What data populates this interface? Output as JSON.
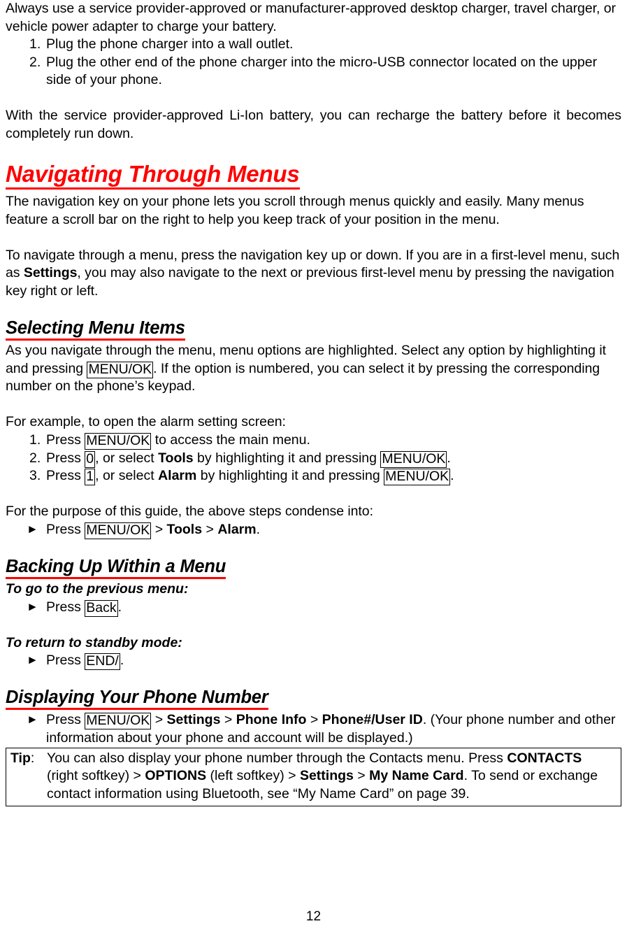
{
  "document": {
    "page_number": "12",
    "intro": {
      "paragraph": "Always use a service provider-approved or manufacturer-approved desktop charger, travel charger, or vehicle power adapter to charge your battery.",
      "steps": [
        {
          "number": "1.",
          "text": "Plug the phone charger into a wall outlet."
        },
        {
          "number": "2.",
          "text": "Plug the other end of the phone charger into the micro-USB connector located on the upper side of your phone."
        }
      ],
      "note": "With the service provider-approved Li-Ion battery, you can recharge the battery before it becomes completely run down."
    },
    "sections": [
      {
        "heading": "Navigating Through Menus",
        "paragraph1": "The navigation key on your phone lets you scroll through menus quickly and easily. Many menus feature a scroll bar on the right to help you keep track of your position in the menu.",
        "paragraph2_a": "To navigate through a menu, press the navigation key up or down. If you are in a first-level menu, such as ",
        "paragraph2_bold": "Settings",
        "paragraph2_b": ", you may also navigate to the next or previous first-level menu by pressing the navigation key right or left."
      },
      {
        "heading": "Selecting Menu Items",
        "paragraph1_a": "As you navigate through the menu, menu options are highlighted. Select any option by highlighting it and pressing ",
        "paragraph1_key": "MENU/OK",
        "paragraph1_b": ". If the option is numbered, you can select it by pressing the corresponding number on the phone’s keypad.",
        "example_intro": "For example, to open the alarm setting screen:",
        "example_steps": [
          {
            "number": "1.",
            "pre": "Press ",
            "key1": "MENU/OK",
            "post": " to access the main menu."
          },
          {
            "number": "2.",
            "pre": "Press ",
            "key1": "0",
            "mid1": ", or select ",
            "bold1": "Tools",
            "mid2": " by highlighting it and pressing ",
            "key2": "MENU/OK",
            "post": "."
          },
          {
            "number": "3.",
            "pre": "Press ",
            "key1": "1",
            "mid1": ", or select ",
            "bold1": "Alarm",
            "mid2": " by highlighting it and pressing ",
            "key2": "MENU/OK",
            "post": "."
          }
        ],
        "condense_intro": "For the purpose of this guide, the above steps condense into:",
        "condense_step": {
          "marker": "►",
          "pre": "Press ",
          "key1": "MENU/OK",
          "sep1": " > ",
          "bold1": "Tools",
          "sep2": " > ",
          "bold2": "Alarm",
          "post": "."
        }
      },
      {
        "heading": "Backing Up Within a Menu",
        "sub1": "To go to the previous menu:",
        "sub1_step": {
          "marker": "►",
          "pre": "Press ",
          "key1": "Back",
          "post": "."
        },
        "sub2": "To return to standby mode:",
        "sub2_step": {
          "marker": "►",
          "pre": "Press ",
          "key1": "END/",
          "post": "."
        }
      },
      {
        "heading": "Displaying Your Phone Number",
        "step": {
          "marker": "►",
          "pre": "Press ",
          "key1": "MENU/OK",
          "sep1": " > ",
          "bold1": "Settings",
          "sep2": " > ",
          "bold2": "Phone Info",
          "sep3": " > ",
          "bold3": "Phone#/User ID",
          "post": ". (Your phone number and other information about your phone and account will be displayed.)"
        }
      }
    ],
    "tip": {
      "label": "Tip",
      "label_colon": ":",
      "part1": " You can also display your phone number through the Contacts menu. Press ",
      "bold1": "CONTACTS",
      "part2": " (right softkey) > ",
      "bold2": "OPTIONS",
      "part3": " (left softkey) > ",
      "bold3": "Settings",
      "part4": " > ",
      "bold4": "My Name Card",
      "part5": ". To send or exchange contact information using Bluetooth, see “My Name Card” on page 39."
    },
    "colors": {
      "heading_red": "#ff0000",
      "text_black": "#000000",
      "page_background": "#ffffff"
    }
  }
}
